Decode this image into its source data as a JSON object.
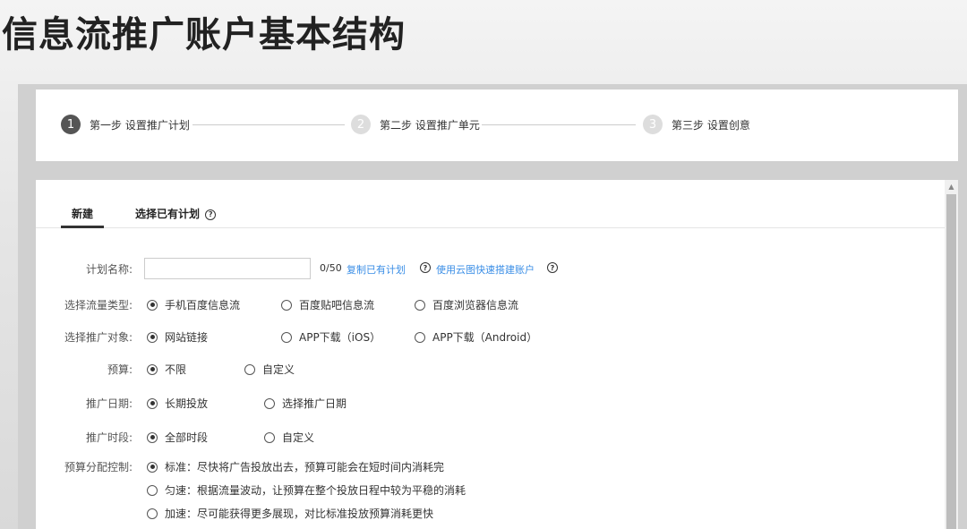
{
  "page_title": "信息流推广账户基本结构",
  "steps": [
    {
      "num": "1",
      "label": "第一步 设置推广计划"
    },
    {
      "num": "2",
      "label": "第二步 设置推广单元"
    },
    {
      "num": "3",
      "label": "第三步 设置创意"
    }
  ],
  "tabs": [
    {
      "label": "新建"
    },
    {
      "label": "选择已有计划"
    }
  ],
  "help_glyph": "?",
  "scroll_up_glyph": "▲",
  "form": {
    "plan_name": {
      "label": "计划名称:",
      "value": "",
      "placeholder": "",
      "counter": "0/50",
      "copy_link": "复制已有计划",
      "cloud_link": "使用云图快速搭建账户"
    },
    "traffic_type": {
      "label": "选择流量类型:",
      "options": [
        "手机百度信息流",
        "百度贴吧信息流",
        "百度浏览器信息流"
      ],
      "selected": "手机百度信息流"
    },
    "promo_target": {
      "label": "选择推广对象:",
      "options": [
        "网站链接",
        "APP下载（iOS）",
        "APP下载（Android）"
      ],
      "selected": "网站链接"
    },
    "budget": {
      "label": "预算:",
      "options": [
        "不限",
        "自定义"
      ],
      "selected": "不限"
    },
    "promo_date": {
      "label": "推广日期:",
      "options": [
        "长期投放",
        "选择推广日期"
      ],
      "selected": "长期投放"
    },
    "promo_time": {
      "label": "推广时段:",
      "options": [
        "全部时段",
        "自定义"
      ],
      "selected": "全部时段"
    },
    "budget_control": {
      "label": "预算分配控制:",
      "options": [
        "标准：尽快将广告投放出去，预算可能会在短时间内消耗完",
        "匀速：根据流量波动，让预算在整个投放日程中较为平稳的消耗",
        "加速：尽可能获得更多展现，对比标准投放预算消耗更快"
      ],
      "selected": "标准：尽快将广告投放出去，预算可能会在短时间内消耗完"
    }
  }
}
